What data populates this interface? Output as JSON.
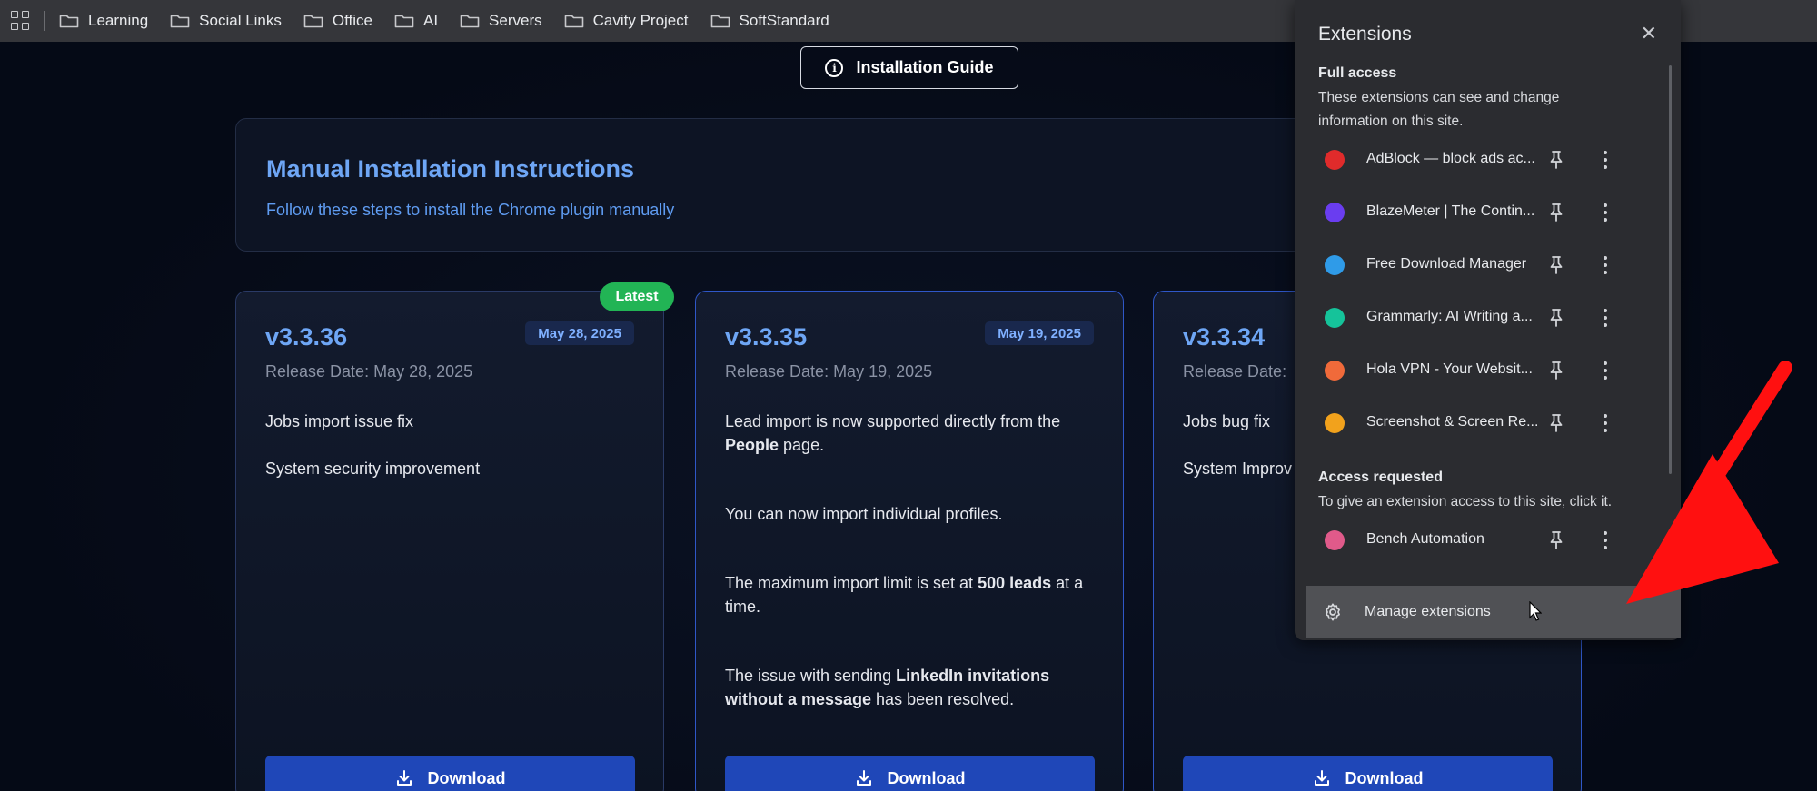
{
  "bookmarks_bar": {
    "items": [
      "Learning",
      "Social Links",
      "Office",
      "AI",
      "Servers",
      "Cavity Project",
      "SoftStandard"
    ]
  },
  "page": {
    "guide_button": "Installation Guide",
    "instructions": {
      "title": "Manual Installation Instructions",
      "subtitle": "Follow these steps to install the Chrome plugin manually"
    },
    "latest_badge": "Latest",
    "cards": [
      {
        "version": "v3.3.36",
        "date_badge": "May 28, 2025",
        "release_date": "Release Date: May 28, 2025",
        "notes": [
          "Jobs import issue fix",
          "System security improvement"
        ],
        "download": "Download"
      },
      {
        "version": "v3.3.35",
        "date_badge": "May 19, 2025",
        "release_date": "Release Date: May 19, 2025",
        "notes_rich": [
          {
            "pre": "Lead import is now supported directly from the ",
            "bold": "People",
            "post": " page."
          },
          {
            "pre": "You can now import individual profiles.",
            "bold": "",
            "post": ""
          },
          {
            "pre": "The maximum import limit is set at ",
            "bold": "500 leads",
            "post": " at a time."
          },
          {
            "pre": "The issue with sending ",
            "bold": "LinkedIn invitations without a message",
            "post": " has been resolved."
          }
        ],
        "download": "Download"
      },
      {
        "version": "v3.3.34",
        "date_badge": "",
        "release_date": "Release Date:",
        "notes": [
          "Jobs bug fix",
          "System Improv"
        ],
        "download": "Download"
      }
    ]
  },
  "extensions_popup": {
    "title": "Extensions",
    "close_icon": "close-icon",
    "full_access": {
      "heading": "Full access",
      "description": "These extensions can see and change information on this site."
    },
    "full_access_items": [
      {
        "name": "AdBlock — block ads ac...",
        "icon_color": "#e02b2b"
      },
      {
        "name": "BlazeMeter | The Contin...",
        "icon_color": "#6a3df0"
      },
      {
        "name": "Free Download Manager",
        "icon_color": "#2f9be8"
      },
      {
        "name": "Grammarly: AI Writing a...",
        "icon_color": "#15c39a"
      },
      {
        "name": "Hola VPN - Your Websit...",
        "icon_color": "#f06a3a"
      },
      {
        "name": "Screenshot & Screen Re...",
        "icon_color": "#f2a21c"
      }
    ],
    "access_requested": {
      "heading": "Access requested",
      "description": "To give an extension access to this site, click it."
    },
    "access_requested_items": [
      {
        "name": "Bench Automation",
        "icon_color": "#e05a8a"
      }
    ],
    "manage_label": "Manage extensions"
  },
  "colors": {
    "accent_blue": "#6ea6f5",
    "download_button": "#1f47b8",
    "latest_green": "#22b455",
    "annotation_arrow": "#ff1010"
  }
}
